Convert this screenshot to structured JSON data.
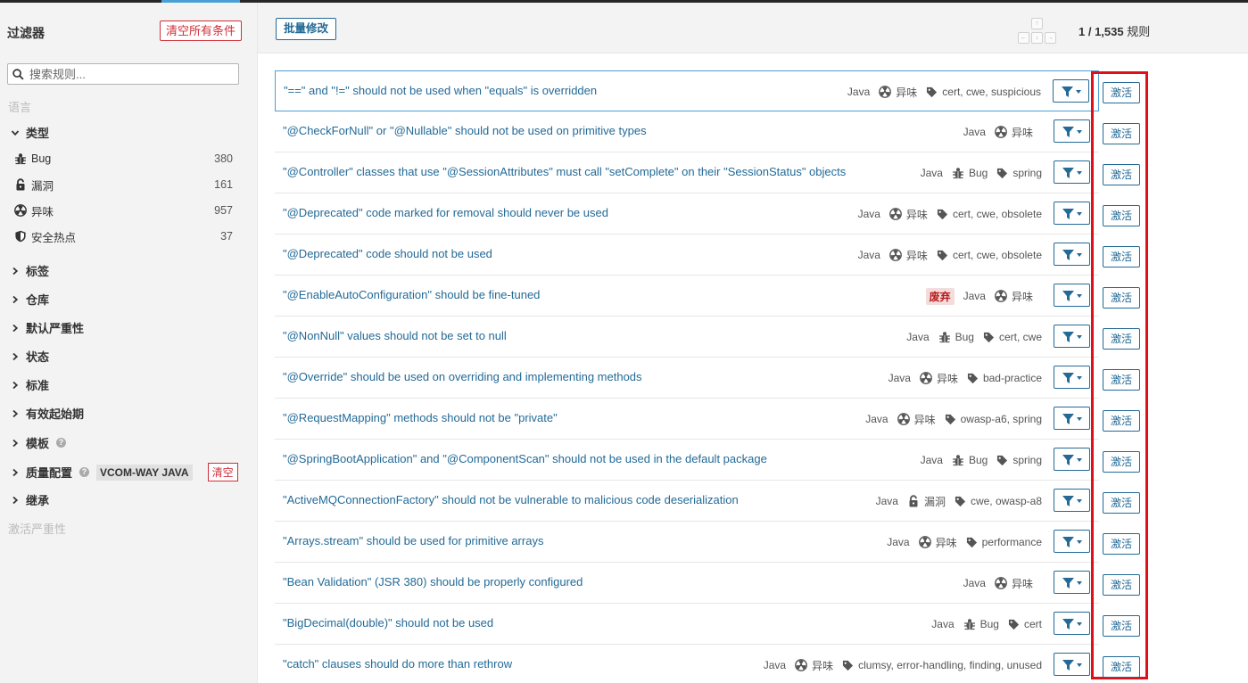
{
  "sidebar": {
    "title": "过滤器",
    "clear_all": "清空所有条件",
    "search_placeholder": "搜索规则...",
    "language_label": "语言",
    "type_label": "类型",
    "types": [
      {
        "label": "Bug",
        "count": "380",
        "icon": "bug-icon"
      },
      {
        "label": "漏洞",
        "count": "161",
        "icon": "lock-icon"
      },
      {
        "label": "异味",
        "count": "957",
        "icon": "radiation-icon"
      },
      {
        "label": "安全热点",
        "count": "37",
        "icon": "shield-icon"
      }
    ],
    "facets": {
      "tags": "标签",
      "repository": "仓库",
      "severity": "默认严重性",
      "status": "状态",
      "standard": "标准",
      "available_since": "有效起始期",
      "template": "模板",
      "quality_profile": "质量配置",
      "inheritance": "继承"
    },
    "profile_name": "VCOM-WAY JAVA",
    "profile_clear": "清空",
    "activation_severity": "激活严重性"
  },
  "toolbar": {
    "bulk_change": "批量修改",
    "count": "1 / 1,535",
    "count_unit": "规则"
  },
  "rules": [
    {
      "title": "\"==\" and \"!=\" should not be used when \"equals\" is overridden",
      "lang": "Java",
      "type": "异味",
      "type_icon": "radiation-icon",
      "tags": "cert, cwe, suspicious",
      "deprecated": ""
    },
    {
      "title": "\"@CheckForNull\" or \"@Nullable\" should not be used on primitive types",
      "lang": "Java",
      "type": "异味",
      "type_icon": "radiation-icon",
      "tags": "",
      "deprecated": ""
    },
    {
      "title": "\"@Controller\" classes that use \"@SessionAttributes\" must call \"setComplete\" on their \"SessionStatus\" objects",
      "lang": "Java",
      "type": "Bug",
      "type_icon": "bug-icon",
      "tags": "spring",
      "deprecated": ""
    },
    {
      "title": "\"@Deprecated\" code marked for removal should never be used",
      "lang": "Java",
      "type": "异味",
      "type_icon": "radiation-icon",
      "tags": "cert, cwe, obsolete",
      "deprecated": ""
    },
    {
      "title": "\"@Deprecated\" code should not be used",
      "lang": "Java",
      "type": "异味",
      "type_icon": "radiation-icon",
      "tags": "cert, cwe, obsolete",
      "deprecated": ""
    },
    {
      "title": "\"@EnableAutoConfiguration\" should be fine-tuned",
      "lang": "Java",
      "type": "异味",
      "type_icon": "radiation-icon",
      "tags": "",
      "deprecated": "废弃"
    },
    {
      "title": "\"@NonNull\" values should not be set to null",
      "lang": "Java",
      "type": "Bug",
      "type_icon": "bug-icon",
      "tags": "cert, cwe",
      "deprecated": ""
    },
    {
      "title": "\"@Override\" should be used on overriding and implementing methods",
      "lang": "Java",
      "type": "异味",
      "type_icon": "radiation-icon",
      "tags": "bad-practice",
      "deprecated": ""
    },
    {
      "title": "\"@RequestMapping\" methods should not be \"private\"",
      "lang": "Java",
      "type": "异味",
      "type_icon": "radiation-icon",
      "tags": "owasp-a6, spring",
      "deprecated": ""
    },
    {
      "title": "\"@SpringBootApplication\" and \"@ComponentScan\" should not be used in the default package",
      "lang": "Java",
      "type": "Bug",
      "type_icon": "bug-icon",
      "tags": "spring",
      "deprecated": ""
    },
    {
      "title": "\"ActiveMQConnectionFactory\" should not be vulnerable to malicious code deserialization",
      "lang": "Java",
      "type": "漏洞",
      "type_icon": "lock-icon",
      "tags": "cwe, owasp-a8",
      "deprecated": ""
    },
    {
      "title": "\"Arrays.stream\" should be used for primitive arrays",
      "lang": "Java",
      "type": "异味",
      "type_icon": "radiation-icon",
      "tags": "performance",
      "deprecated": ""
    },
    {
      "title": "\"Bean Validation\" (JSR 380) should be properly configured",
      "lang": "Java",
      "type": "异味",
      "type_icon": "radiation-icon",
      "tags": "",
      "deprecated": ""
    },
    {
      "title": "\"BigDecimal(double)\" should not be used",
      "lang": "Java",
      "type": "Bug",
      "type_icon": "bug-icon",
      "tags": "cert",
      "deprecated": ""
    },
    {
      "title": "\"catch\" clauses should do more than rethrow",
      "lang": "Java",
      "type": "异味",
      "type_icon": "radiation-icon",
      "tags": "clumsy, error-handling, finding, unused",
      "deprecated": ""
    }
  ],
  "activate_label": "激活",
  "colors": {
    "link": "#236a97",
    "danger": "#d02f3a",
    "highlight_box": "#e0101a",
    "selected_border": "#4b9fd5"
  }
}
